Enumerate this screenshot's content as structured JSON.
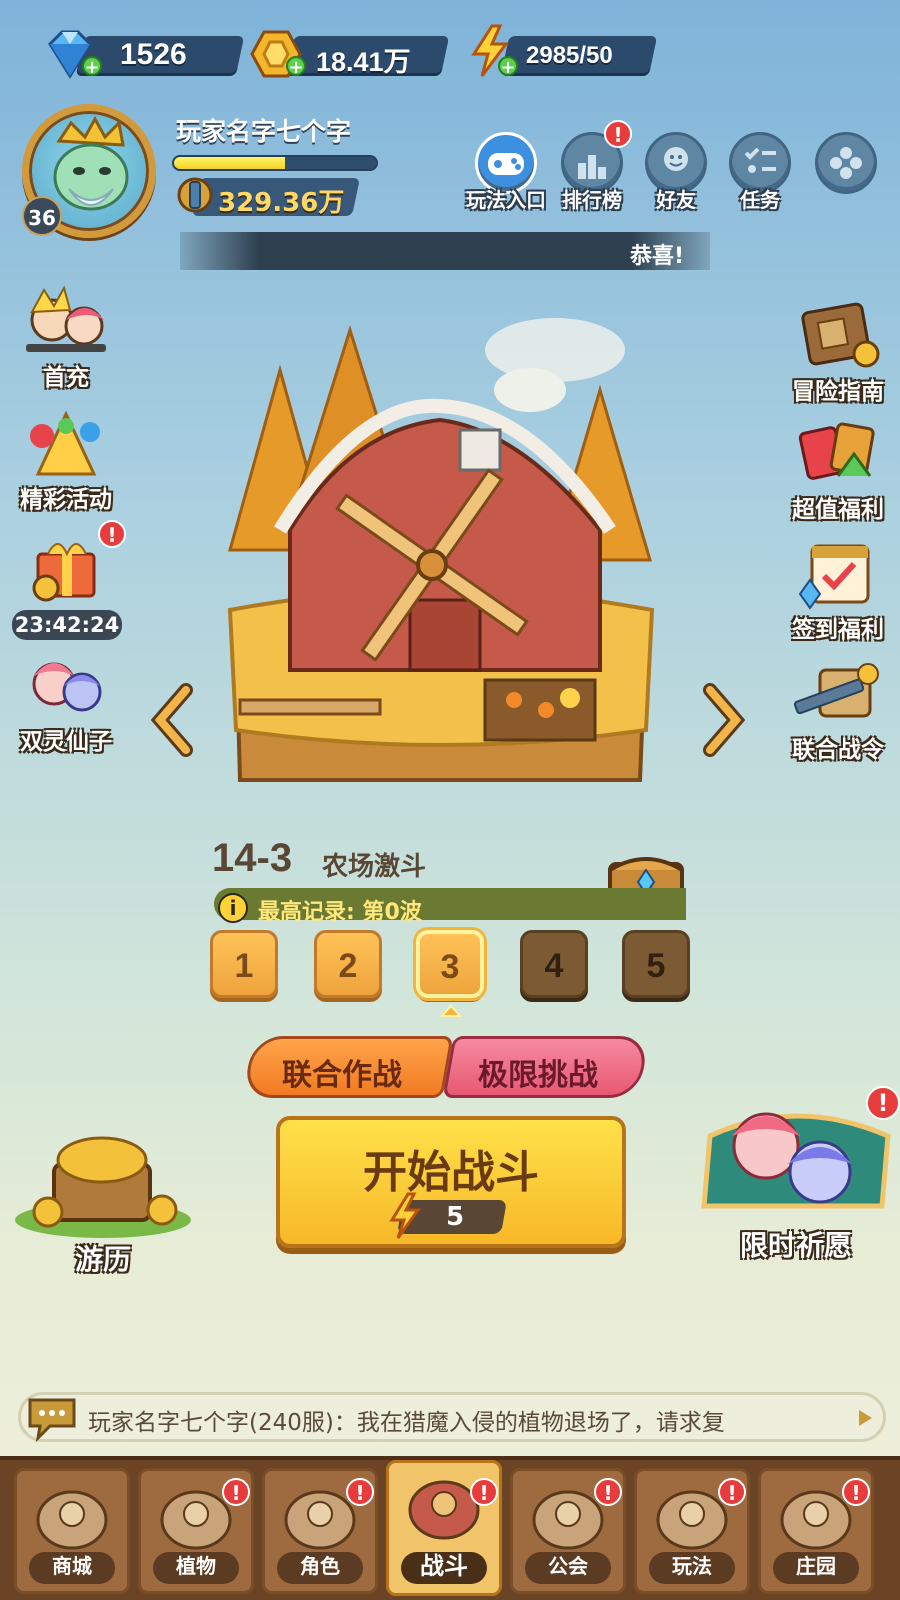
{
  "currency": {
    "diamonds": "1526",
    "gold": "18.41万",
    "energy": "2985/50"
  },
  "player": {
    "name": "玩家名字七个字",
    "level": "36",
    "power": "329.36万",
    "exp_progress": 0.55
  },
  "top_buttons": [
    {
      "label": "玩法入口"
    },
    {
      "label": "排行榜"
    },
    {
      "label": "好友"
    },
    {
      "label": "任务"
    }
  ],
  "notice": "恭喜!",
  "left_side": [
    {
      "label": "首充"
    },
    {
      "label": "精彩活动"
    },
    {
      "label": "23:42:24"
    },
    {
      "label": "双灵仙子"
    }
  ],
  "right_side": [
    {
      "label": "冒险指南"
    },
    {
      "label": "超值福利"
    },
    {
      "label": "签到福利"
    },
    {
      "label": "联合战令"
    }
  ],
  "stage": {
    "number": "14-3",
    "name": "农场激斗",
    "record": "最高记录: 第0波",
    "waves": [
      "1",
      "2",
      "3",
      "4",
      "5"
    ],
    "selected_wave": 3,
    "unlocked_waves": 3
  },
  "modes": {
    "coop": "联合作战",
    "extreme": "极限挑战"
  },
  "start": {
    "label": "开始战斗",
    "cost": "5"
  },
  "travel": "游历",
  "wish": "限时祈愿",
  "chat": "玩家名字七个字(240服)：我在猎魔入侵的植物退场了，请求复",
  "nav": [
    {
      "label": "商城"
    },
    {
      "label": "植物"
    },
    {
      "label": "角色"
    },
    {
      "label": "战斗"
    },
    {
      "label": "公会"
    },
    {
      "label": "玩法"
    },
    {
      "label": "庄园"
    }
  ],
  "colors": {
    "accent": "#f5b63a",
    "alert": "#e83b3b"
  }
}
